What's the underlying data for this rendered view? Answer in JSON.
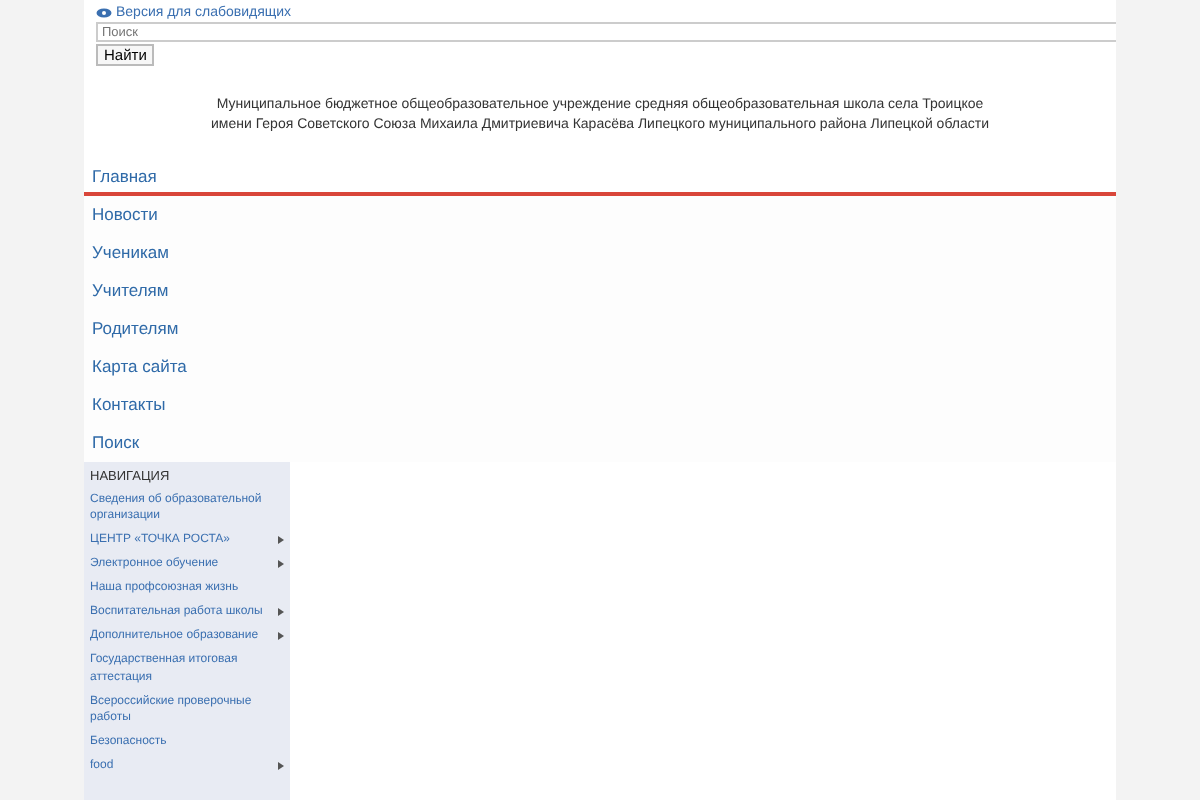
{
  "accessibility_link": "Версия для слабовидящих",
  "search": {
    "placeholder": "Поиск",
    "button": "Найти"
  },
  "header": {
    "lines": [
      "Муниципальное бюджетное общеобразовательное учреждение средняя общеобразовательная школа села Троицкое",
      "имени Героя Советского Союза Михаила Дмитриевича Карасёва Липецкого муниципального района Липецкой области"
    ]
  },
  "menu": [
    {
      "label": "Главная",
      "selected": true
    },
    {
      "label": "Новости",
      "selected": false
    },
    {
      "label": "Ученикам",
      "selected": false
    },
    {
      "label": "Учителям",
      "selected": false
    },
    {
      "label": "Родителям",
      "selected": false
    },
    {
      "label": "Карта сайта",
      "selected": false
    },
    {
      "label": "Контакты",
      "selected": false
    },
    {
      "label": "Поиск",
      "selected": false
    }
  ],
  "sidebar": {
    "title": "НАВИГАЦИЯ",
    "items": [
      {
        "label": "Сведения об образовательной организации",
        "has_submenu": false
      },
      {
        "label": "ЦЕНТР «ТОЧКА РОСТА»",
        "has_submenu": true
      },
      {
        "label": "Электронное обучение",
        "has_submenu": true
      },
      {
        "label": "Наша профсоюзная жизнь",
        "has_submenu": false
      },
      {
        "label": "Воспитательная работа школы",
        "has_submenu": true
      },
      {
        "label": "Дополнительное образование",
        "has_submenu": true
      },
      {
        "label": "Государственная итоговая аттестация",
        "has_submenu": false
      },
      {
        "label": "Всероссийские проверочные работы",
        "has_submenu": false
      },
      {
        "label": "Безопасность",
        "has_submenu": false
      },
      {
        "label": "food",
        "has_submenu": true
      }
    ]
  }
}
